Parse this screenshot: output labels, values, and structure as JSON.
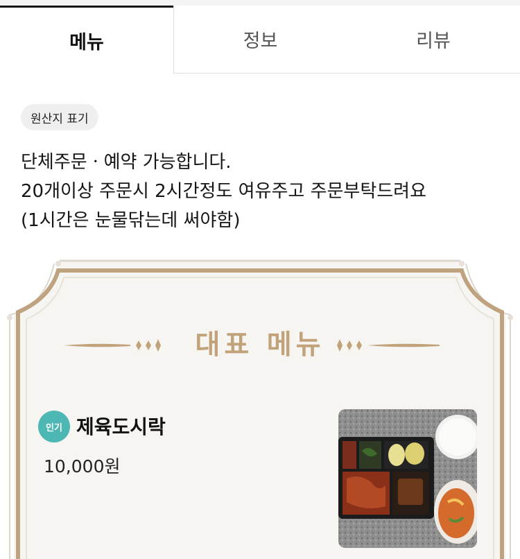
{
  "tabs": [
    {
      "label": "메뉴"
    },
    {
      "label": "정보"
    },
    {
      "label": "리뷰"
    }
  ],
  "origin_chip": "원산지 표기",
  "notice": {
    "lines": [
      "단체주문ㆍ예약  가능합니다.",
      "20개이상 주문시 2시간정도 여유주고 주문부탁드려요",
      "(1시간은 눈물닦는데 써야함)"
    ]
  },
  "card": {
    "title": "대표 메뉴",
    "items": [
      {
        "badge": "인기",
        "name": "제육도시락",
        "price": "10,000원"
      }
    ]
  },
  "colors": {
    "accent_gold": "#c2a27a",
    "badge_teal": "#4db8b3",
    "card_paper": "#f7f5f2"
  }
}
